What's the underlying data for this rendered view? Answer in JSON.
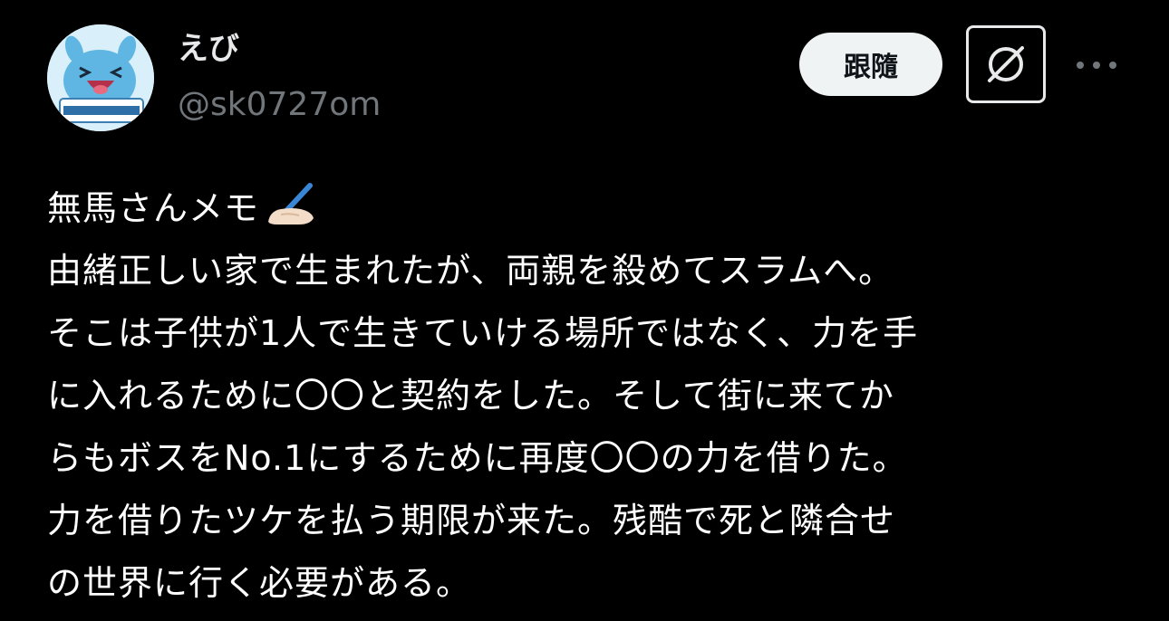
{
  "author": {
    "name": "えび",
    "handle": "@sk0727om"
  },
  "actions": {
    "follow_label": "跟隨",
    "grok_icon": "grok-icon",
    "more_icon": "more-horizontal-icon"
  },
  "post": {
    "lines": [
      "無馬さんメモ",
      "由緒正しい家で生まれたが、両親を殺めてスラムへ。",
      "そこは子供が1人で生きていける場所ではなく、力を手",
      "に入れるために〇〇と契約をした。そして街に来てか",
      "らもボスをNo.1にするために再度〇〇の力を借りた。",
      "力を借りたツケを払う期限が来た。残酷で死と隣合せ",
      "の世界に行く必要がある。"
    ],
    "emoji": "writing-hand-icon"
  },
  "colors": {
    "background": "#000000",
    "text": "#ffffff",
    "secondary_text": "#71767b",
    "button_bg": "#eff3f4"
  }
}
